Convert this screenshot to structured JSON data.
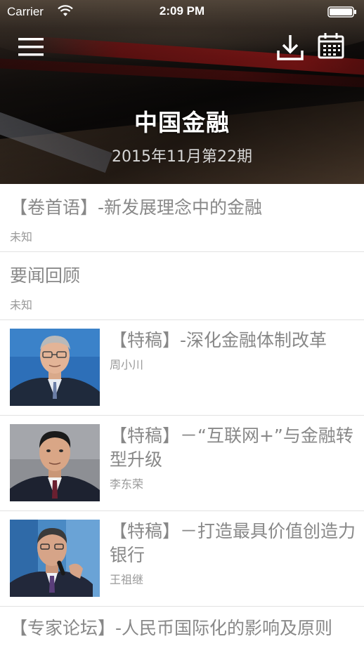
{
  "status_bar": {
    "carrier": "Carrier",
    "time": "2:09 PM"
  },
  "header": {
    "title": "中国金融",
    "issue": "2015年11月第22期"
  },
  "articles": [
    {
      "title": "【卷首语】-新发展理念中的金融",
      "author": "未知",
      "thumbnail": false
    },
    {
      "title": "要闻回顾",
      "author": "未知",
      "thumbnail": false
    },
    {
      "title": "【特稿】-深化金融体制改革",
      "author": "周小川",
      "thumbnail": true
    },
    {
      "title": "【特稿】－“互联网+”与金融转型升级",
      "author": "李东荣",
      "thumbnail": true
    },
    {
      "title": "【特稿】－打造最具价值创造力银行",
      "author": "王祖继",
      "thumbnail": true
    },
    {
      "title": "【专家论坛】-人民币国际化的影响及原则",
      "author": "",
      "thumbnail": false
    }
  ],
  "icons": [
    "menu-icon",
    "download-icon",
    "calendar-icon",
    "wifi-icon",
    "battery-icon"
  ],
  "colors": {
    "title_text": "#888888",
    "author_text": "#999999",
    "divider": "#e2e2e2"
  }
}
